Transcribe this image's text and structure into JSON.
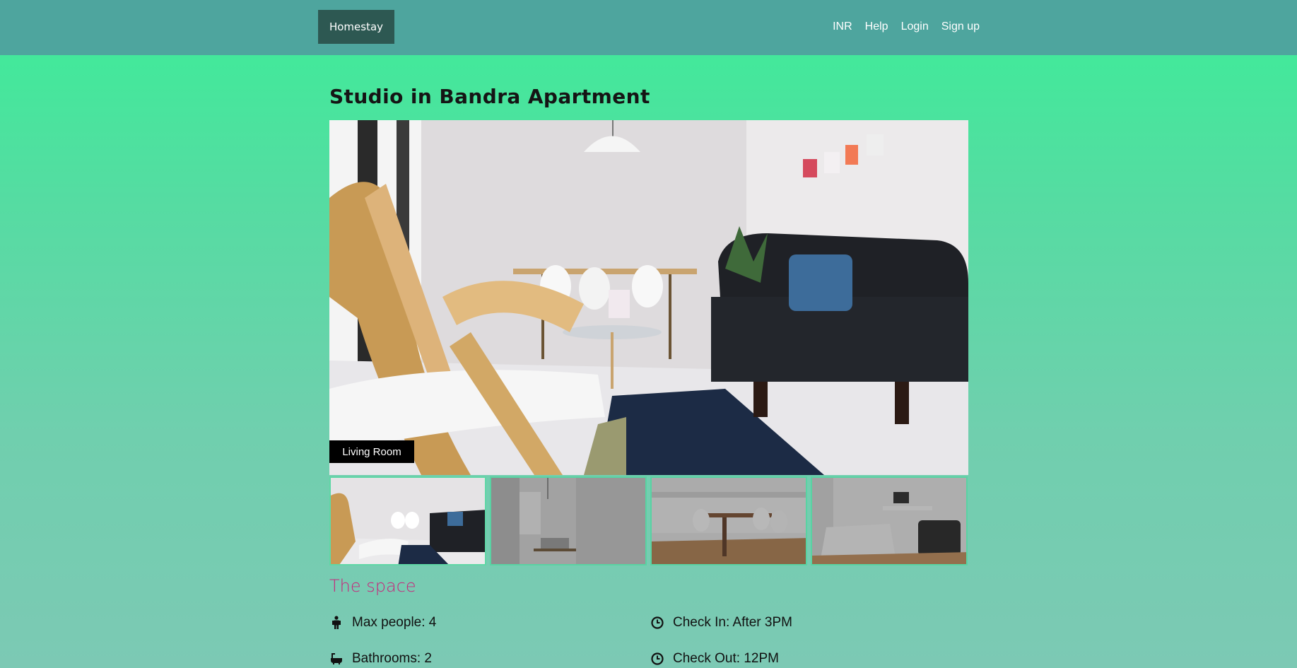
{
  "navbar": {
    "brand": "Homestay",
    "links": [
      "INR",
      "Help",
      "Login",
      "Sign up"
    ]
  },
  "listing": {
    "title": "Studio in Bandra Apartment",
    "main_photo_caption": "Living Room",
    "thumbnail_count": 4
  },
  "space": {
    "heading": "The space",
    "features": [
      {
        "icon": "person-icon",
        "text": "Max people: 4"
      },
      {
        "icon": "clock-icon",
        "text": "Check In: After 3PM"
      },
      {
        "icon": "bathtub-icon",
        "text": "Bathrooms: 2"
      },
      {
        "icon": "clock-icon",
        "text": "Check Out: 12PM"
      }
    ]
  },
  "colors": {
    "navbar": "#4ea59e",
    "brand_bg": "#2d5852",
    "accent_heading": "#c8247a"
  }
}
